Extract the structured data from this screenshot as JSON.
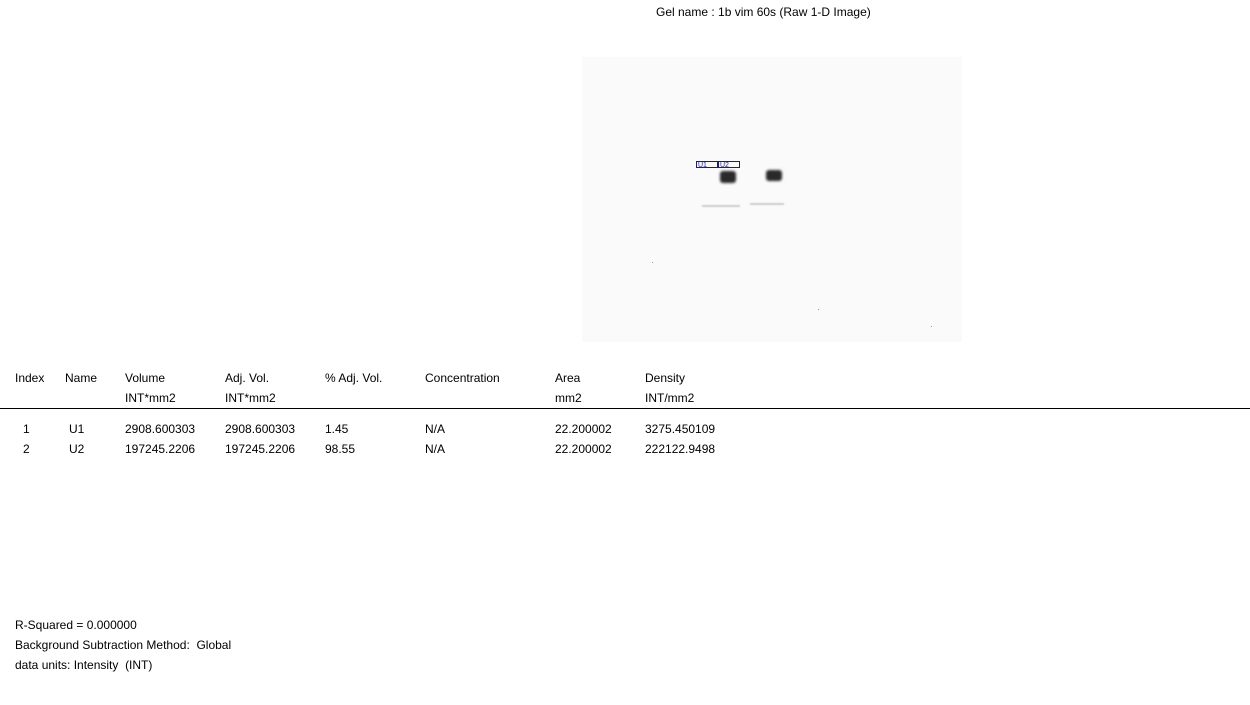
{
  "gel": {
    "title": "Gel name : 1b vim 60s (Raw 1-D Image)",
    "rois": [
      "U1",
      "U2"
    ]
  },
  "table": {
    "headers": [
      {
        "label": "Index",
        "unit": ""
      },
      {
        "label": "Name",
        "unit": ""
      },
      {
        "label": "Volume",
        "unit": "INT*mm2"
      },
      {
        "label": "Adj. Vol.",
        "unit": "INT*mm2"
      },
      {
        "label": "% Adj. Vol.",
        "unit": ""
      },
      {
        "label": "Concentration",
        "unit": ""
      },
      {
        "label": "Area",
        "unit": "mm2"
      },
      {
        "label": "Density",
        "unit": "INT/mm2"
      }
    ],
    "rows": [
      [
        "1",
        "U1",
        "2908.600303",
        "2908.600303",
        "1.45",
        "N/A",
        "22.200002",
        "3275.450109"
      ],
      [
        "2",
        "U2",
        "197245.2206",
        "197245.2206",
        "98.55",
        "N/A",
        "22.200002",
        "222122.9498"
      ]
    ]
  },
  "footer": {
    "r_squared": "R-Squared = 0.000000",
    "background_method": "Background Subtraction Method:  Global",
    "data_units": "data units: Intensity  (INT)"
  }
}
